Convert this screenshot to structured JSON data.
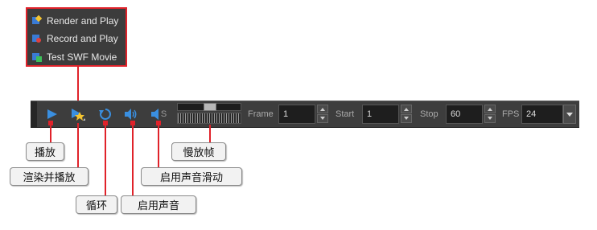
{
  "menu": {
    "items": [
      {
        "label": "Render and Play",
        "icon": "render-play-icon"
      },
      {
        "label": "Record and Play",
        "icon": "record-play-icon"
      },
      {
        "label": "Test SWF Movie",
        "icon": "swf-movie-icon"
      }
    ]
  },
  "toolbar": {
    "frame_label": "Frame",
    "frame_value": "1",
    "start_label": "Start",
    "start_value": "1",
    "stop_label": "Stop",
    "stop_value": "60",
    "fps_label": "FPS",
    "fps_value": "24",
    "sound_scrub_suffix": "S"
  },
  "callouts": {
    "play": "播放",
    "render_and_play": "渲染并播放",
    "loop": "循环",
    "enable_sound": "启用声音",
    "enable_sound_scrubbing": "启用声音滑动",
    "slow_play": "慢放帧"
  },
  "colors": {
    "accent_red": "#e0222a",
    "toolbar_bg": "#3d3d3d",
    "icon_blue": "#3a8fe0"
  }
}
